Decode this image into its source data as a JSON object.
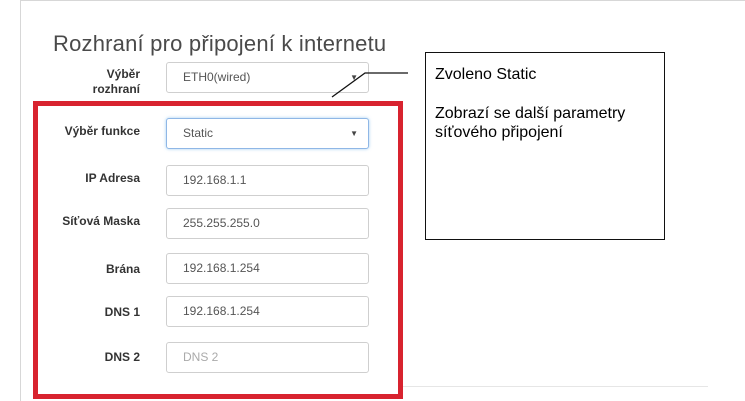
{
  "section_title": "Rozhraní pro připojení k internetu",
  "interface_select": {
    "label_line1": "Výběr",
    "label_line2": "rozhraní",
    "value": "ETH0(wired)"
  },
  "function_select": {
    "label": "Výběr funkce",
    "value": "Static"
  },
  "fields": {
    "ip": {
      "label": "IP Adresa",
      "value": "192.168.1.1"
    },
    "mask": {
      "label": "Síťová Maska",
      "value": "255.255.255.0"
    },
    "gateway": {
      "label": "Brána",
      "value": "192.168.1.254"
    },
    "dns1": {
      "label": "DNS 1",
      "value": "192.168.1.254"
    },
    "dns2": {
      "label": "DNS 2",
      "value": "",
      "placeholder": "DNS 2"
    }
  },
  "caret_glyph": "▼",
  "callout": {
    "line1": "Zvoleno Static",
    "line2": "Zobrazí se další parametry síťového připojení"
  },
  "colors": {
    "highlight_border": "#d8232f",
    "focus_border": "#8fb7e6",
    "text": "#333333"
  }
}
